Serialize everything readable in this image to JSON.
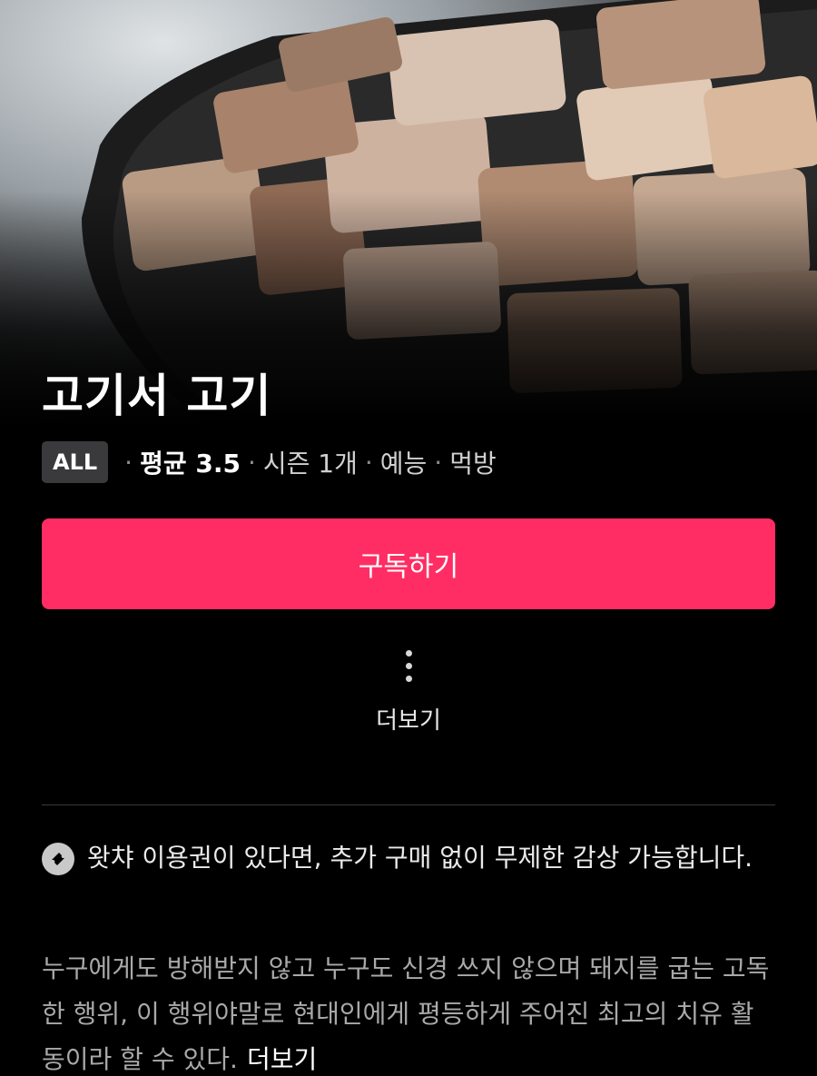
{
  "show": {
    "title": "고기서 고기",
    "rating_badge": "ALL",
    "average": "평균 3.5",
    "seasons": "시즌 1개",
    "genre": "예능",
    "subgenre": "먹방",
    "separator": "·"
  },
  "actions": {
    "subscribe_label": "구독하기",
    "more_label": "더보기"
  },
  "notice": {
    "text": "왓챠 이용권이 있다면, 추가 구매 없이 무제한 감상 가능합니다."
  },
  "description": {
    "text": "누구에게도 방해받지 않고 누구도 신경 쓰지 않으며 돼지를 굽는 고독한 행위, 이 행위야말로 현대인에게 평등하게 주어진 최고의 치유 활동이라 할 수 있다.",
    "more_label": "더보기"
  },
  "colors": {
    "accent": "#ff2d63",
    "background": "#000000"
  },
  "icons": {
    "more": "vertical-dots-icon",
    "notice": "ticket-icon"
  }
}
